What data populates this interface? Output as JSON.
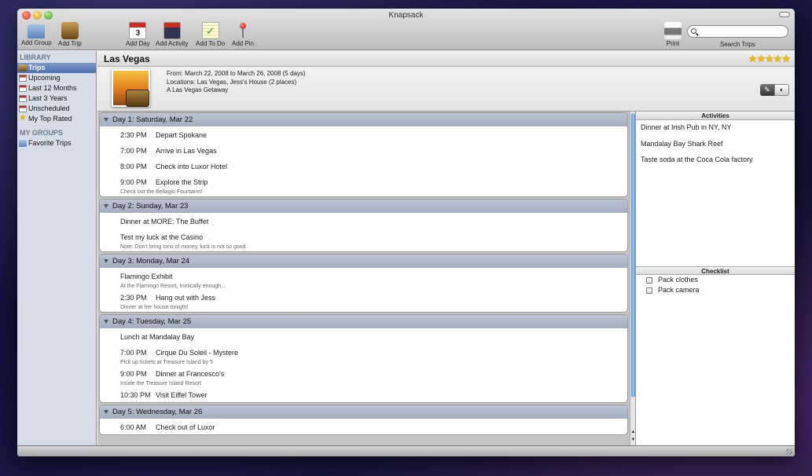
{
  "window": {
    "title": "Knapsack"
  },
  "toolbar": {
    "add_group": "Add Group",
    "add_trip": "Add Trip",
    "add_day": "Add Day",
    "add_activity": "Add Activity",
    "add_todo": "Add To Do",
    "add_pin": "Add Pin",
    "print": "Print",
    "search_label": "Search Trips",
    "search_value": ""
  },
  "sidebar": {
    "library_header": "LIBRARY",
    "items": [
      "Trips",
      "Upcoming",
      "Last 12 Months",
      "Last 3 Years",
      "Unscheduled",
      "My Top Rated"
    ],
    "groups_header": "MY GROUPS",
    "groups": [
      "Favorite Trips"
    ]
  },
  "trip": {
    "title": "Las Vegas",
    "rating": 5,
    "stars": "★★★★★",
    "dates": "From:  March 22, 2008   to   March 26, 2008  (5 days)",
    "locations": "Locations: Las Vegas, Jess's House  (2 places)",
    "description": "A Las Vegas Getaway"
  },
  "days": [
    {
      "header": "Day 1:  Saturday, Mar 22",
      "events": [
        {
          "time": "2:30 PM",
          "name": "Depart Spokane",
          "note": ""
        },
        {
          "time": "7:00 PM",
          "name": "Arrive in Las Vegas",
          "note": ""
        },
        {
          "time": "8:00 PM",
          "name": "Check into Luxor Hotel",
          "note": ""
        },
        {
          "time": "9:00 PM",
          "name": "Explore the Strip",
          "note": "Check out the Bellagio Fountains!"
        }
      ]
    },
    {
      "header": "Day 2:  Sunday, Mar 23",
      "events": [
        {
          "time": "",
          "name": "Dinner at MORE: The Buffet",
          "note": ""
        },
        {
          "time": "",
          "name": "Test my luck at the Casino",
          "note": "Note: Don't bring tons of money, luck is not so good."
        }
      ]
    },
    {
      "header": "Day 3:  Monday, Mar 24",
      "events": [
        {
          "time": "",
          "name": "Flamingo Exhibit",
          "note": "At the Flamingo Resort, ironically enough..."
        },
        {
          "time": "2:30 PM",
          "name": "Hang out with Jess",
          "note": "Dinner at her house tonight!"
        }
      ]
    },
    {
      "header": "Day 4:  Tuesday, Mar 25",
      "events": [
        {
          "time": "",
          "name": "Lunch at Mandalay Bay",
          "note": ""
        },
        {
          "time": "7:00 PM",
          "name": "Cirque Du Soleil - Mystere",
          "note": "Pick up tickets at Treasure Island by 5"
        },
        {
          "time": "9:00 PM",
          "name": "Dinner at Francesco's",
          "note": "Inside the Treasure Island Resort"
        },
        {
          "time": "10:30 PM",
          "name": "Visit Eiffel Tower",
          "note": ""
        }
      ]
    },
    {
      "header": "Day 5:  Wednesday, Mar 26",
      "events": [
        {
          "time": "6:00 AM",
          "name": "Check out of Luxor",
          "note": ""
        }
      ]
    }
  ],
  "activities": {
    "header": "Activities",
    "items": [
      "Dinner at Irish Pub in NY, NY",
      "Mandalay Bay Shark Reef",
      "Taste soda at the Coca Cola factory"
    ]
  },
  "checklist": {
    "header": "Checklist",
    "items": [
      "Pack clothes",
      "Pack camera"
    ]
  },
  "colors": {
    "accent": "#5071ad",
    "day_header": "#a4aec0",
    "star": "#f0b800"
  }
}
